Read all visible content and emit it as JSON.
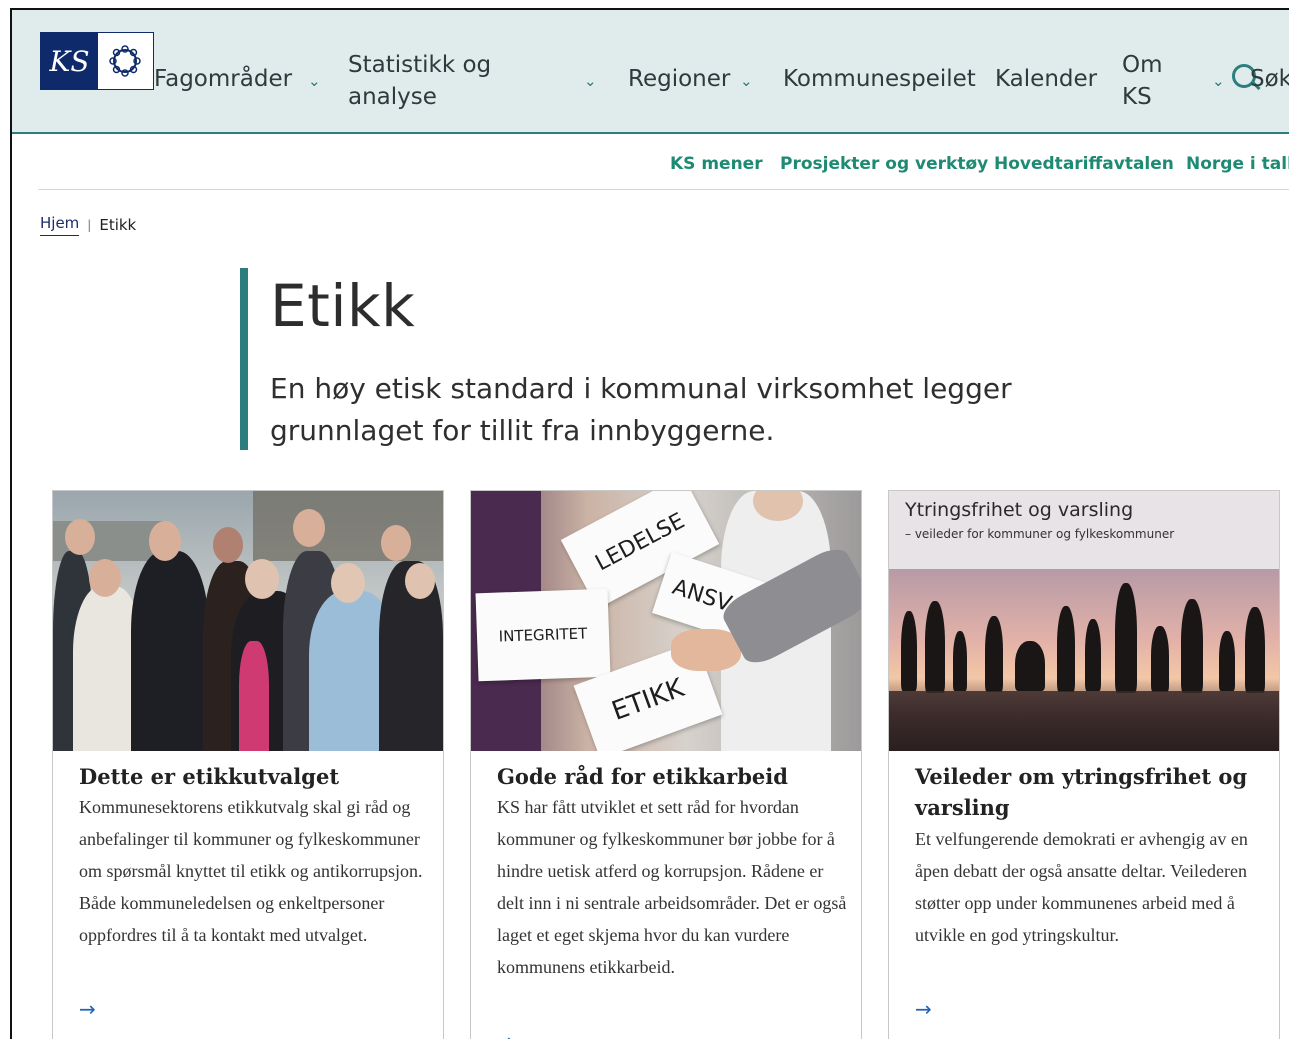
{
  "header": {
    "logo_text": "KS",
    "nav": [
      {
        "label": "Fagområder"
      },
      {
        "label_line1": "Statistikk og",
        "label_line2": "analyse"
      },
      {
        "label": "Regioner"
      },
      {
        "label": "Kommunespeilet"
      },
      {
        "label": "Kalender"
      },
      {
        "label_line1": "Om",
        "label_line2": "KS"
      }
    ],
    "search_label": "Søk"
  },
  "subnav": [
    "KS mener",
    "Prosjekter og verktøy",
    "Hovedtariffavtalen",
    "Norge i tall"
  ],
  "breadcrumb": {
    "home": "Hjem",
    "current": "Etikk"
  },
  "hero": {
    "title": "Etikk",
    "lead": "En høy etisk standard i kommunal virksomhet legger grunnlaget for tillit fra innbyggerne."
  },
  "cards": [
    {
      "title": "Dette er etikkutvalget",
      "description": "Kommunesektorens etikkutvalg skal gi råd og anbefalinger til kommuner og fylkeskommuner om spørsmål knyttet til etikk og antikorrupsjon. Både kommuneledelsen og enkeltpersoner oppfordres til å ta kontakt med utvalget.",
      "arrow": "→"
    },
    {
      "title": "Gode råd for etikkarbeid",
      "description": "KS har fått utviklet et sett råd for hvordan kommuner og fylkeskommuner bør jobbe for å hindre uetisk atferd og korrupsjon. Rådene er delt inn i ni sentrale arbeidsområder. Det er også laget et eget skjema hvor du kan vurdere kommunens etikkarbeid.",
      "arrow": "→",
      "image_signs": [
        "LEDELSE",
        "ANSVA",
        "INTEGRITET",
        "ETIKK"
      ]
    },
    {
      "title": "Veileder om ytringsfrihet og varsling",
      "description": "Et velfungerende demokrati er avhengig av en åpen debatt der også ansatte deltar. Veilederen støtter opp under kommunenes arbeid med å utvikle en god ytringskultur.",
      "arrow": "→",
      "image_title": "Ytringsfrihet og varsling",
      "image_subtitle": "– veileder for kommuner og fylkeskommuner"
    }
  ],
  "colors": {
    "header_bg": "#dfeceb",
    "accent": "#2d7d7e",
    "subnav_link": "#1f8a73",
    "logo_blue": "#0f2a6b"
  }
}
